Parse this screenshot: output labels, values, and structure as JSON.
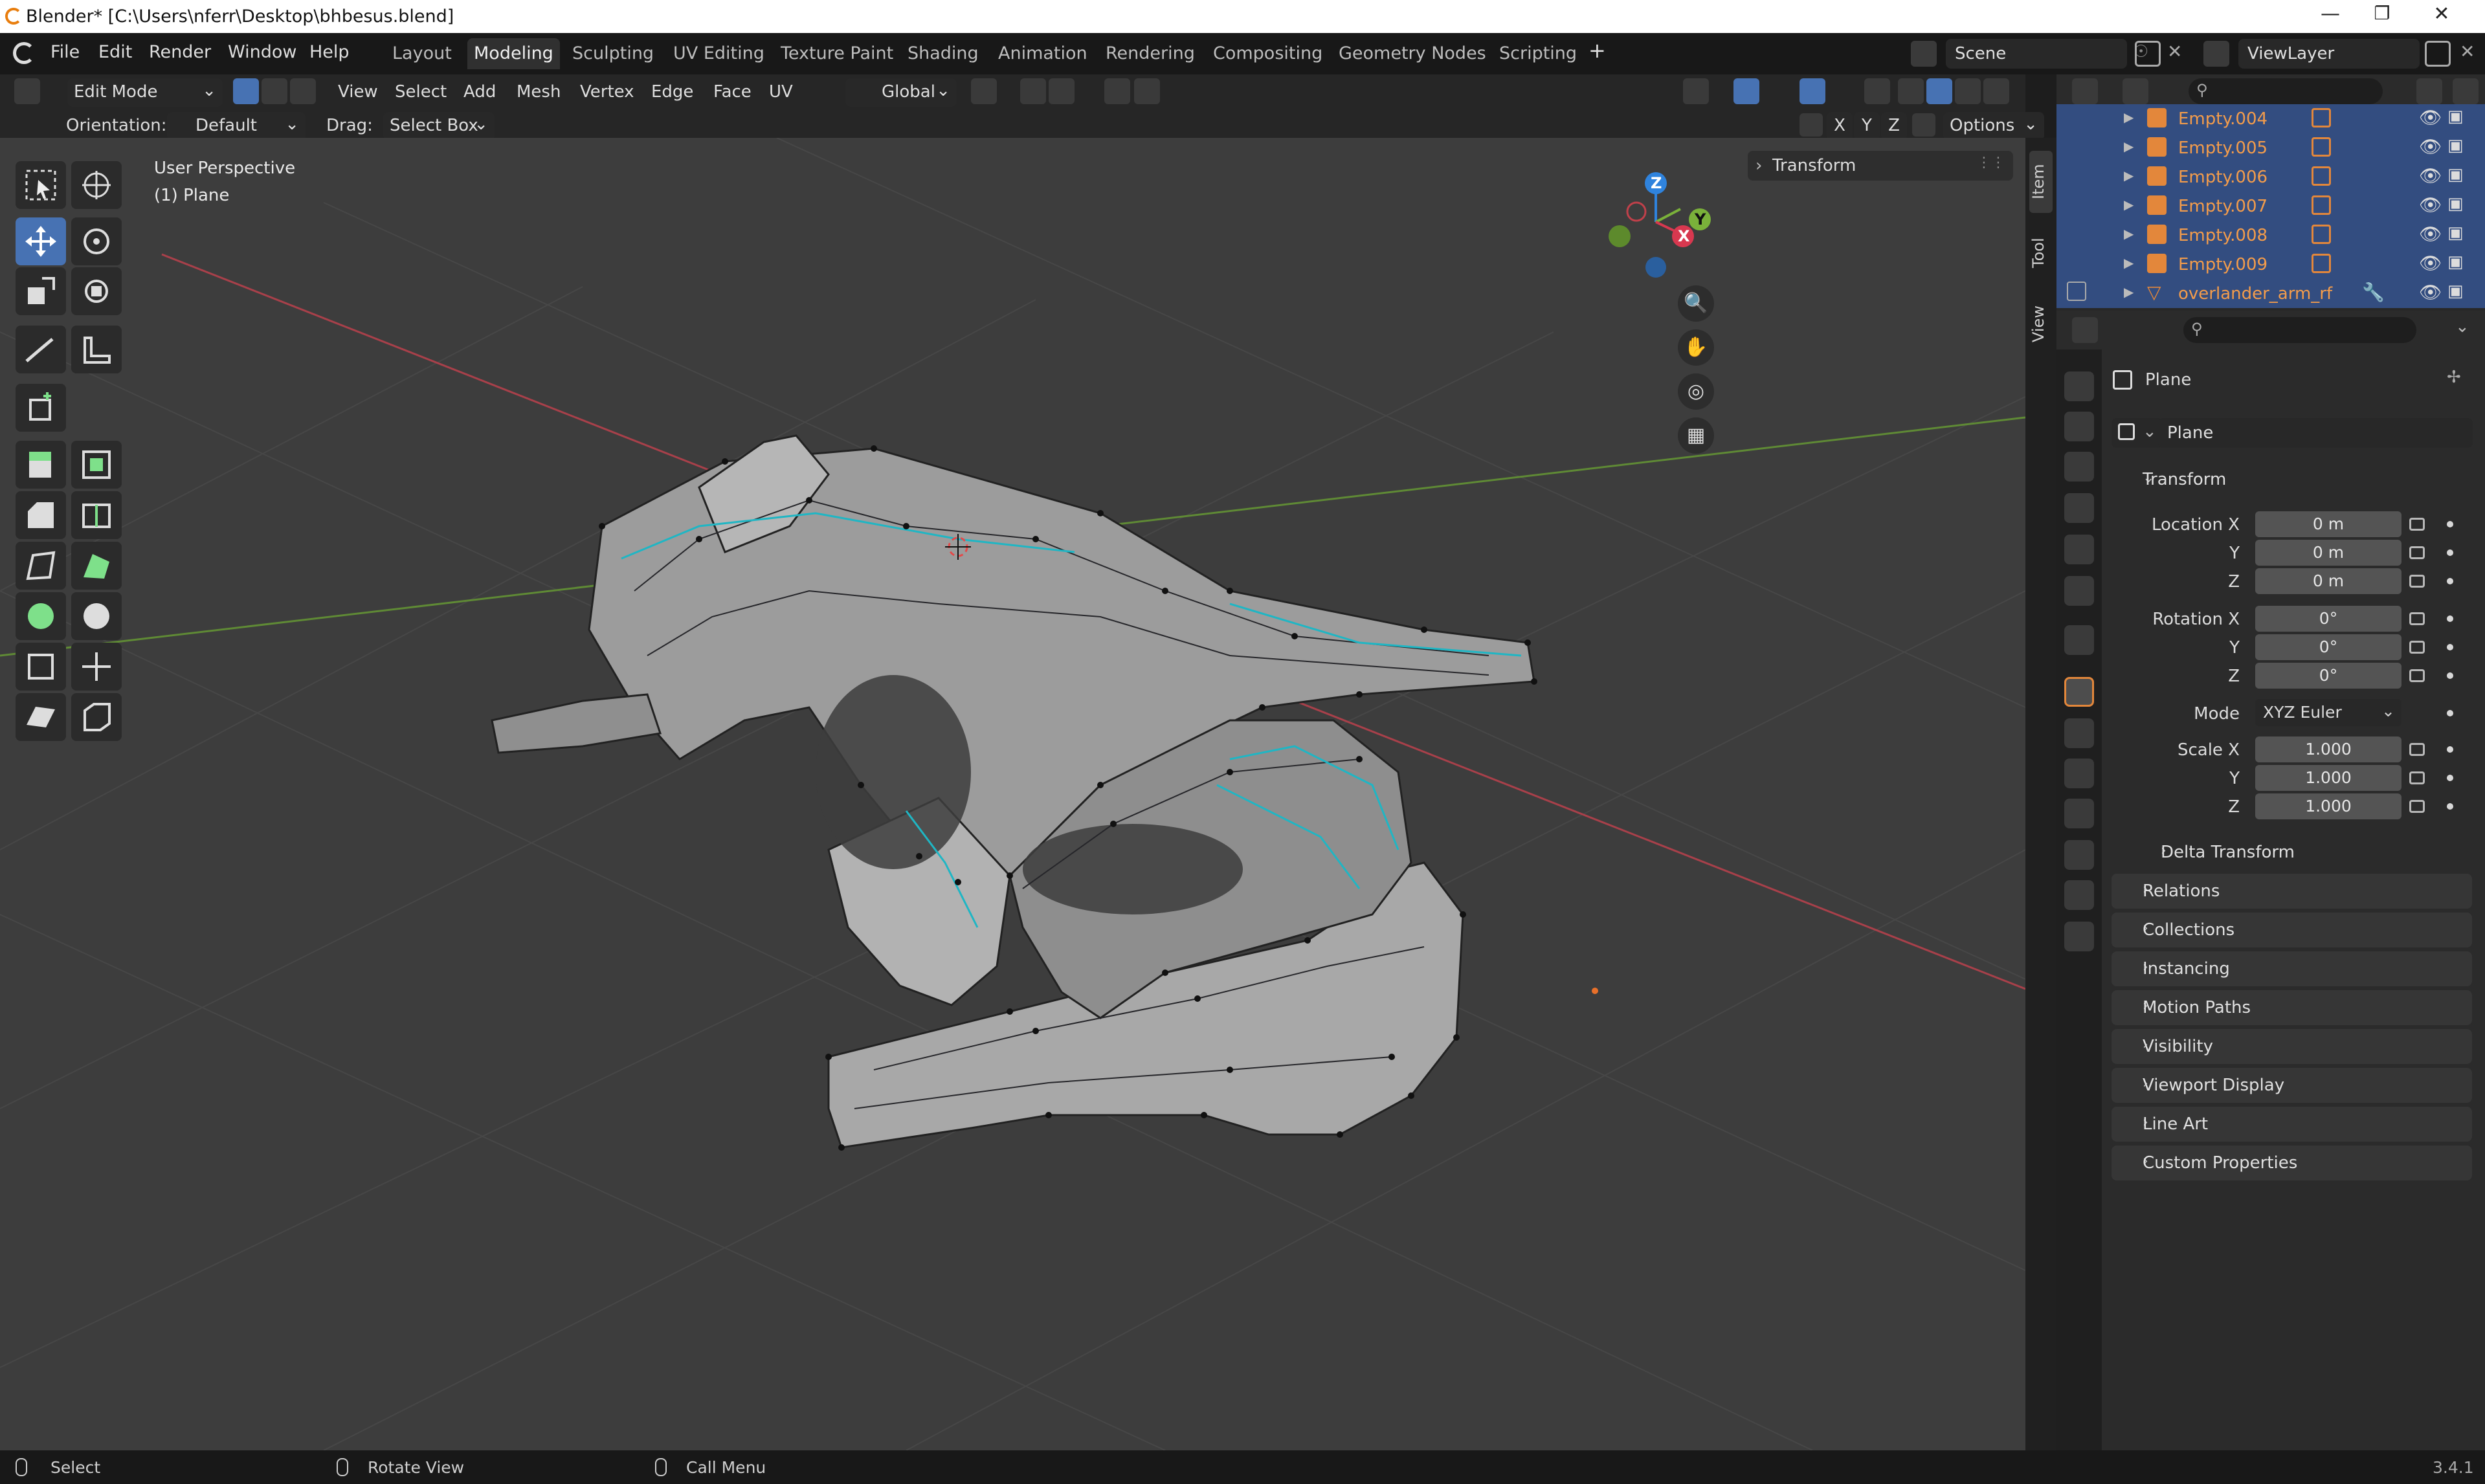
{
  "window": {
    "title": "Blender* [C:\\Users\\nferr\\Desktop\\bhbesus.blend]",
    "controls": [
      "minimize-icon",
      "maximize-icon",
      "close-icon"
    ]
  },
  "menubar": {
    "menus": [
      "File",
      "Edit",
      "Render",
      "Window",
      "Help"
    ],
    "workspaces": [
      "Layout",
      "Modeling",
      "Sculpting",
      "UV Editing",
      "Texture Paint",
      "Shading",
      "Animation",
      "Rendering",
      "Compositing",
      "Geometry Nodes",
      "Scripting"
    ],
    "active_workspace": "Modeling",
    "add_workspace": "+",
    "scene": "Scene",
    "view_layer": "ViewLayer"
  },
  "header": {
    "mode": "Edit Mode",
    "menus": [
      "View",
      "Select",
      "Add",
      "Mesh",
      "Vertex",
      "Edge",
      "Face",
      "UV"
    ],
    "transform_orientation": "Global",
    "axes": [
      "X",
      "Y",
      "Z"
    ],
    "options": "Options",
    "orientation_label": "Orientation:",
    "orientation_value": "Default",
    "drag_label": "Drag:",
    "drag_value": "Select Box"
  },
  "viewport": {
    "view_name": "User Perspective",
    "object_name": "(1) Plane",
    "gizmo_axes": [
      "Z",
      "Y",
      "X"
    ],
    "transform_panel": "Transform",
    "accent_colors": {
      "selected_edge": "#1fb6c4",
      "x_axis": "#d8384f",
      "y_axis": "#7ab13a",
      "z_axis": "#2f83dd"
    }
  },
  "npanel_tabs": [
    "Item",
    "Tool",
    "View"
  ],
  "outliner": {
    "items": [
      {
        "name": "Empty.004"
      },
      {
        "name": "Empty.005"
      },
      {
        "name": "Empty.006"
      },
      {
        "name": "Empty.007"
      },
      {
        "name": "Empty.008"
      },
      {
        "name": "Empty.009"
      },
      {
        "name": "overlander_arm_rf"
      }
    ]
  },
  "properties": {
    "context_name": "Plane",
    "object_name": "Plane",
    "transform_title": "Transform",
    "location": {
      "label": "Location X",
      "x": "0 m",
      "y": "0 m",
      "z": "0 m"
    },
    "rotation": {
      "label": "Rotation X",
      "x": "0°",
      "y": "0°",
      "z": "0°"
    },
    "mode_label": "Mode",
    "mode_value": "XYZ Euler",
    "scale": {
      "label": "Scale X",
      "x": "1.000",
      "y": "1.000",
      "z": "1.000"
    },
    "axis_y": "Y",
    "axis_z": "Z",
    "delta_transform": "Delta Transform",
    "panels": [
      "Relations",
      "Collections",
      "Instancing",
      "Motion Paths",
      "Visibility",
      "Viewport Display",
      "Line Art",
      "Custom Properties"
    ]
  },
  "statusbar": {
    "select": "Select",
    "rotate": "Rotate View",
    "call_menu": "Call Menu",
    "version": "3.4.1"
  }
}
